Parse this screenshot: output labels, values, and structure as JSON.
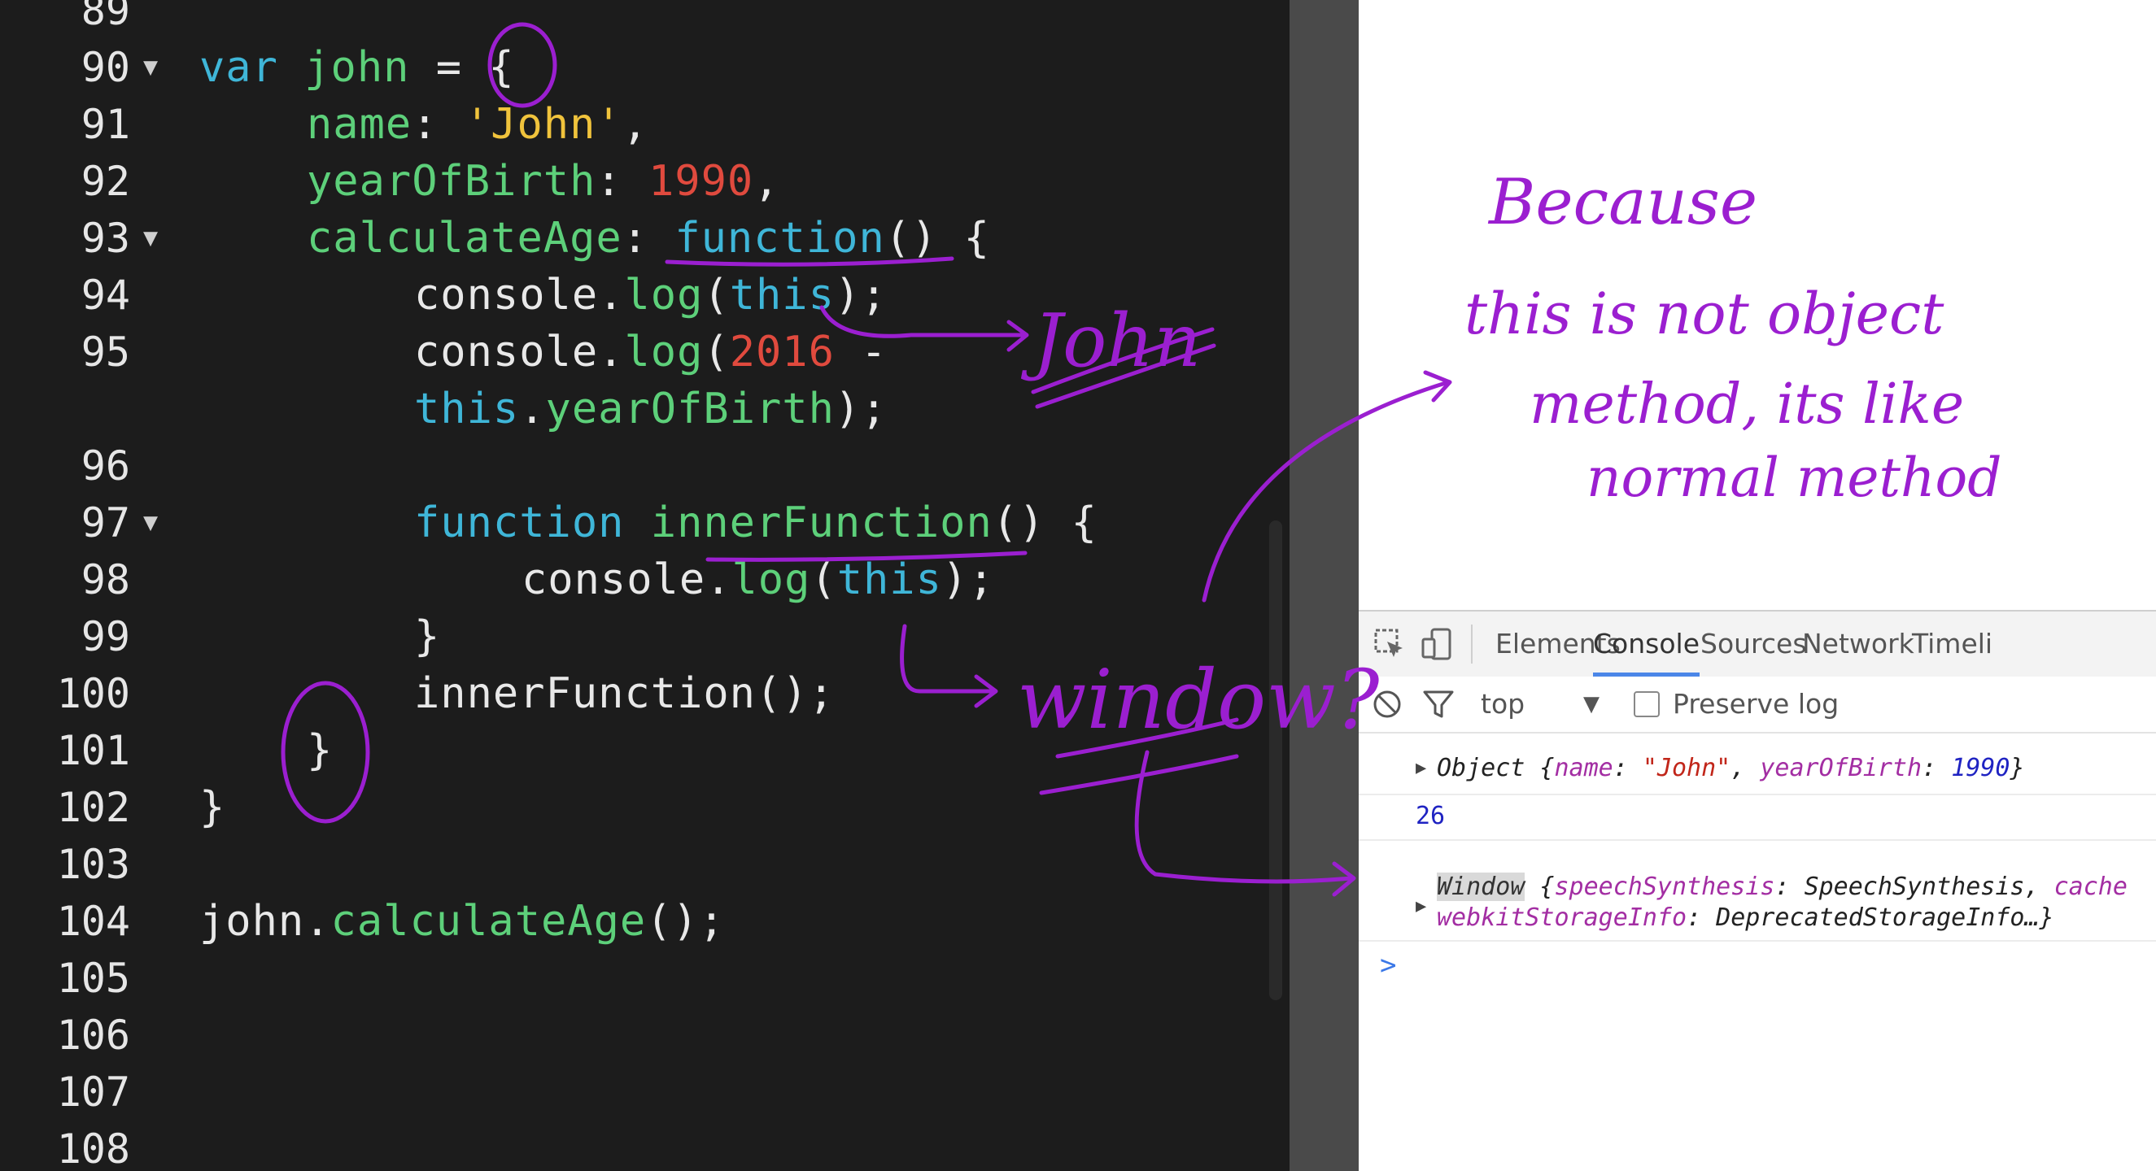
{
  "editor": {
    "lines": [
      {
        "num": "89",
        "fold": false,
        "indent": 0,
        "tokens": []
      },
      {
        "num": "90",
        "fold": true,
        "indent": 0,
        "tokens": [
          [
            "kw",
            "var "
          ],
          [
            "fn",
            "john"
          ],
          [
            "pl",
            " = {"
          ]
        ]
      },
      {
        "num": "91",
        "fold": false,
        "indent": 4,
        "tokens": [
          [
            "fn",
            "name"
          ],
          [
            "pl",
            ": "
          ],
          [
            "str",
            "'John'"
          ],
          [
            "pl",
            ","
          ]
        ]
      },
      {
        "num": "92",
        "fold": false,
        "indent": 4,
        "tokens": [
          [
            "fn",
            "yearOfBirth"
          ],
          [
            "pl",
            ": "
          ],
          [
            "num",
            "1990"
          ],
          [
            "pl",
            ","
          ]
        ]
      },
      {
        "num": "93",
        "fold": true,
        "indent": 4,
        "tokens": [
          [
            "fn",
            "calculateAge"
          ],
          [
            "pl",
            ": "
          ],
          [
            "kw",
            "function"
          ],
          [
            "pl",
            "() {"
          ]
        ]
      },
      {
        "num": "94",
        "fold": false,
        "indent": 8,
        "tokens": [
          [
            "pl",
            "console."
          ],
          [
            "fn",
            "log"
          ],
          [
            "pl",
            "("
          ],
          [
            "kw",
            "this"
          ],
          [
            "pl",
            ");"
          ]
        ]
      },
      {
        "num": "95",
        "fold": false,
        "indent": 8,
        "tokens": [
          [
            "pl",
            "console."
          ],
          [
            "fn",
            "log"
          ],
          [
            "pl",
            "("
          ],
          [
            "num",
            "2016"
          ],
          [
            "pl",
            " -"
          ]
        ]
      },
      {
        "num": "",
        "fold": false,
        "indent": 8,
        "tokens": [
          [
            "kw",
            "this"
          ],
          [
            "pl",
            "."
          ],
          [
            "fn",
            "yearOfBirth"
          ],
          [
            "pl",
            ");"
          ]
        ]
      },
      {
        "num": "96",
        "fold": false,
        "indent": 0,
        "tokens": []
      },
      {
        "num": "97",
        "fold": true,
        "indent": 8,
        "tokens": [
          [
            "kw",
            "function "
          ],
          [
            "fn",
            "innerFunction"
          ],
          [
            "pl",
            "() {"
          ]
        ]
      },
      {
        "num": "98",
        "fold": false,
        "indent": 12,
        "tokens": [
          [
            "pl",
            "console."
          ],
          [
            "fn",
            "log"
          ],
          [
            "pl",
            "("
          ],
          [
            "kw",
            "this"
          ],
          [
            "pl",
            ");"
          ]
        ]
      },
      {
        "num": "99",
        "fold": false,
        "indent": 8,
        "tokens": [
          [
            "pl",
            "}"
          ]
        ]
      },
      {
        "num": "100",
        "fold": false,
        "indent": 8,
        "tokens": [
          [
            "pl",
            "innerFunction();"
          ]
        ]
      },
      {
        "num": "101",
        "fold": false,
        "indent": 4,
        "tokens": [
          [
            "pl",
            "}"
          ]
        ]
      },
      {
        "num": "102",
        "fold": false,
        "indent": 0,
        "tokens": [
          [
            "pl",
            "}"
          ]
        ]
      },
      {
        "num": "103",
        "fold": false,
        "indent": 0,
        "tokens": []
      },
      {
        "num": "104",
        "fold": false,
        "indent": 0,
        "tokens": [
          [
            "pl",
            "john."
          ],
          [
            "fn",
            "calculateAge"
          ],
          [
            "pl",
            "();"
          ]
        ]
      },
      {
        "num": "105",
        "fold": false,
        "indent": 0,
        "tokens": []
      },
      {
        "num": "106",
        "fold": false,
        "indent": 0,
        "tokens": []
      },
      {
        "num": "107",
        "fold": false,
        "indent": 0,
        "tokens": []
      },
      {
        "num": "108",
        "fold": false,
        "indent": 0,
        "tokens": []
      }
    ]
  },
  "devtools": {
    "tabs": [
      "Elements",
      "Console",
      "Sources",
      "Network",
      "Timeli"
    ],
    "active_tab": "Console",
    "icons": [
      "inspect-element-icon",
      "device-toolbar-icon"
    ],
    "filter": {
      "context": "top",
      "preserve_log_label": "Preserve log"
    },
    "console": {
      "object_line": {
        "prefix": "Object {",
        "name_key": "name",
        "name_value": "\"John\"",
        "year_key": "yearOfBirth",
        "year_value": "1990",
        "suffix": "}"
      },
      "number_line": "26",
      "window_line": {
        "prefix": "Window",
        "part1_key": "speechSynthesis",
        "part1_value": "SpeechSynthesis,",
        "part1_tail": "cache",
        "part2_key": "webkitStorageInfo",
        "part2_value": "DeprecatedStorageInfo…}"
      },
      "prompt": ">"
    }
  },
  "annotations": {
    "color": "#9b1fd0",
    "john_label": "John",
    "window_label": "window?",
    "note_lines": [
      "Because",
      "this is not object",
      "method, its like",
      "normal method"
    ]
  },
  "colors": {
    "editor_bg": "#1c1c1c",
    "keyword": "#3fb6d8",
    "identifier": "#5dd07a",
    "string": "#f0c33c",
    "number": "#e04a3e",
    "active_tab_underline": "#4b86e8"
  }
}
